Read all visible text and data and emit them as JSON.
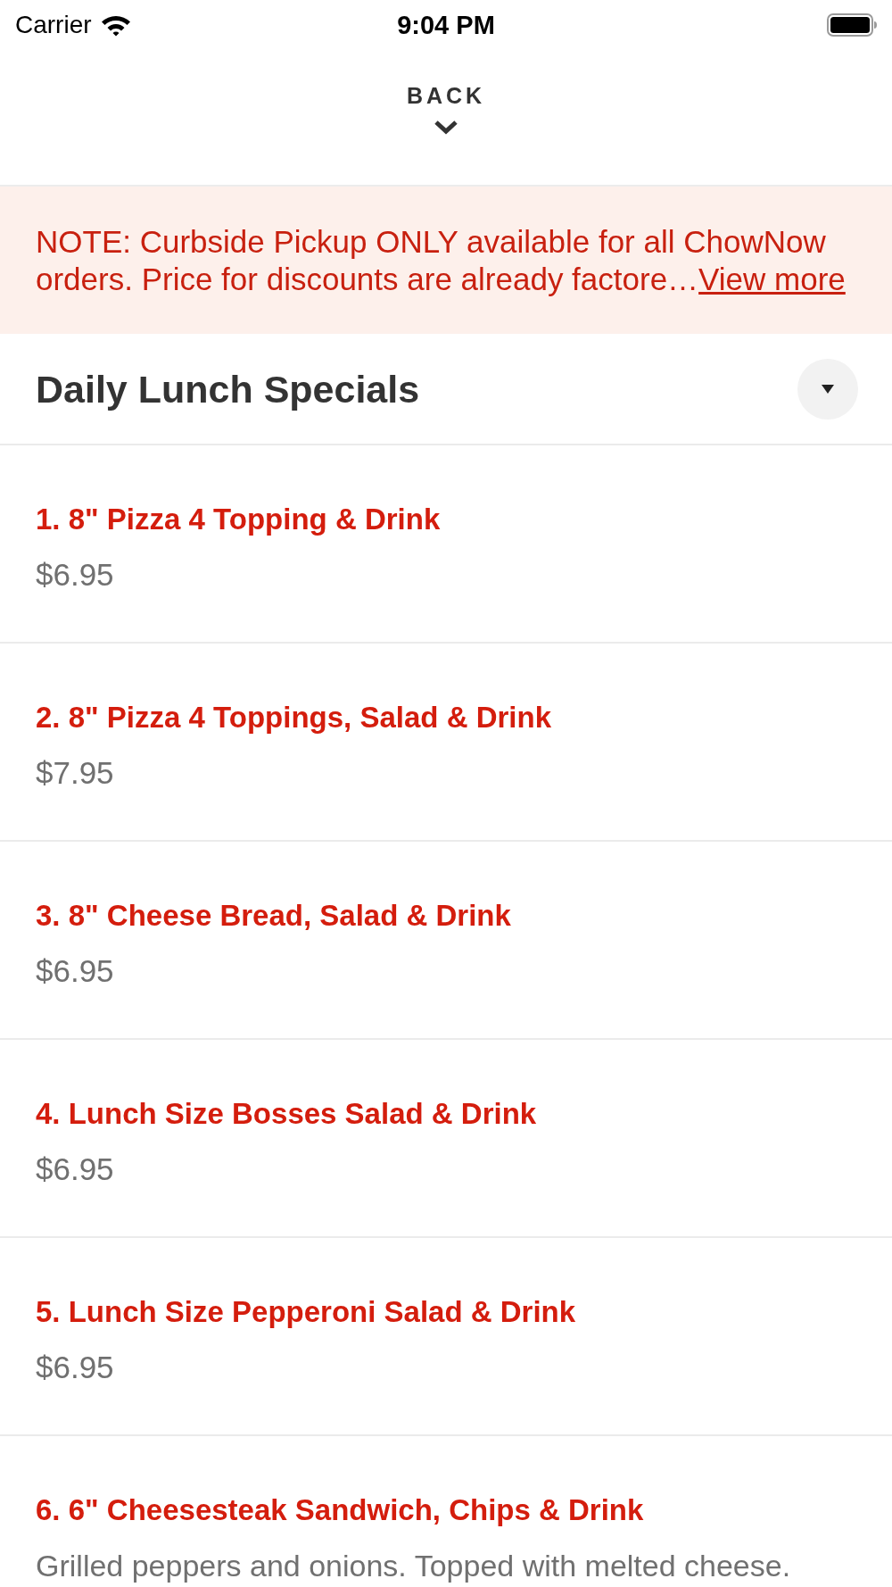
{
  "status_bar": {
    "carrier": "Carrier",
    "time": "9:04 PM"
  },
  "header": {
    "back_label": "BACK"
  },
  "notice": {
    "text": "NOTE: Curbside Pickup ONLY available for all ChowNow orders. Price for discounts are already factore…",
    "link": "View more"
  },
  "section": {
    "title": "Daily Lunch Specials"
  },
  "items": [
    {
      "name": "1. 8\" Pizza 4 Topping & Drink",
      "price": "$6.95"
    },
    {
      "name": "2. 8\" Pizza 4 Toppings, Salad & Drink",
      "price": "$7.95"
    },
    {
      "name": "3. 8\" Cheese Bread, Salad & Drink",
      "price": "$6.95"
    },
    {
      "name": "4. Lunch Size Bosses Salad & Drink",
      "price": "$6.95"
    },
    {
      "name": "5. Lunch Size Pepperoni Salad & Drink",
      "price": "$6.95"
    },
    {
      "name": "6. 6\" Cheesesteak Sandwich, Chips & Drink",
      "description": "Grilled peppers and onions. Topped with melted cheese."
    }
  ]
}
